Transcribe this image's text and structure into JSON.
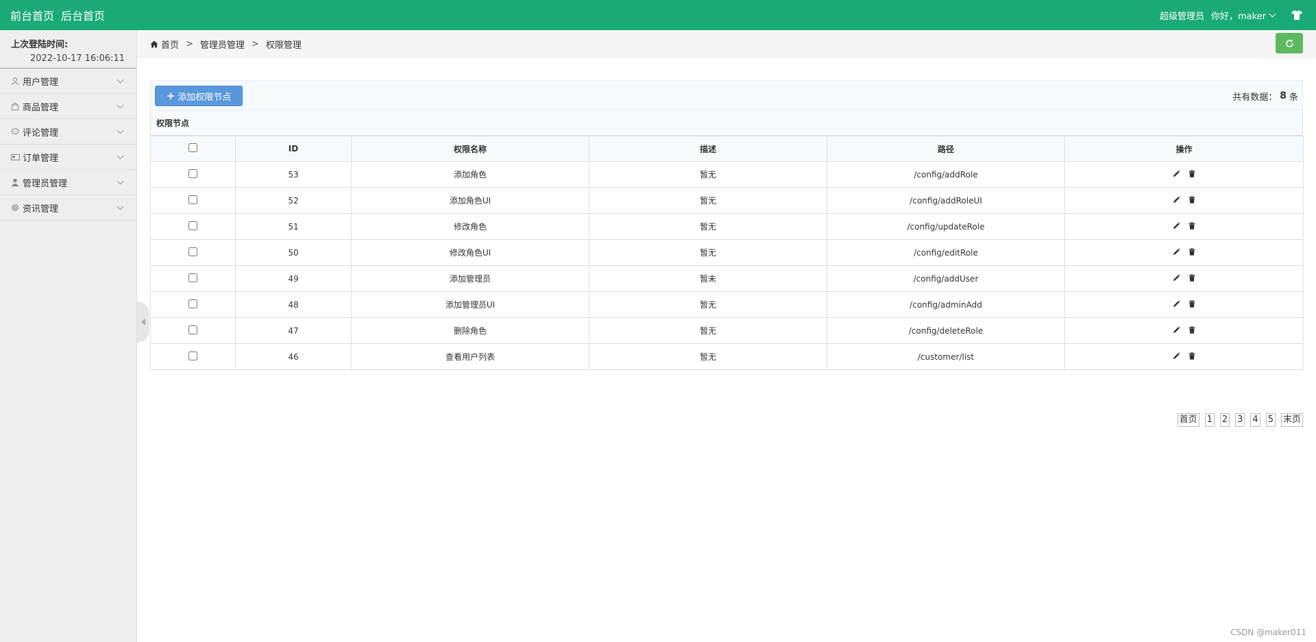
{
  "topbar": {
    "front_home": "前台首页",
    "back_home": "后台首页",
    "role": "超级管理员",
    "greeting": "你好，maker",
    "accent": "#1aaa78"
  },
  "sidebar": {
    "login_label": "上次登陆时间:",
    "login_time": "2022-10-17 16:06:11",
    "items": [
      {
        "label": "用户管理",
        "icon": "user-icon"
      },
      {
        "label": "商品管理",
        "icon": "bag-icon"
      },
      {
        "label": "评论管理",
        "icon": "comment-icon"
      },
      {
        "label": "订单管理",
        "icon": "card-icon"
      },
      {
        "label": "管理员管理",
        "icon": "admin-icon"
      },
      {
        "label": "资讯管理",
        "icon": "gear-icon"
      }
    ]
  },
  "breadcrumb": {
    "home": "首页",
    "sep": ">",
    "level1": "管理员管理",
    "level2": "权限管理"
  },
  "toolbar": {
    "add_label": "添加权限节点",
    "total_prefix": "共有数据：",
    "total_count": "8",
    "total_suffix": "条"
  },
  "table": {
    "caption": "权限节点",
    "headers": {
      "id": "ID",
      "name": "权限名称",
      "desc": "描述",
      "path": "路径",
      "ops": "操作"
    },
    "rows": [
      {
        "id": "53",
        "name": "添加角色",
        "desc": "暂无",
        "path": "/config/addRole"
      },
      {
        "id": "52",
        "name": "添加角色UI",
        "desc": "暂无",
        "path": "/config/addRoleUI"
      },
      {
        "id": "51",
        "name": "修改角色",
        "desc": "暂无",
        "path": "/config/updateRole"
      },
      {
        "id": "50",
        "name": "修改角色UI",
        "desc": "暂无",
        "path": "/config/editRole"
      },
      {
        "id": "49",
        "name": "添加管理员",
        "desc": "暂未",
        "path": "/config/addUser"
      },
      {
        "id": "48",
        "name": "添加管理员UI",
        "desc": "暂无",
        "path": "/config/adminAdd"
      },
      {
        "id": "47",
        "name": "删除角色",
        "desc": "暂无",
        "path": "/config/deleteRole"
      },
      {
        "id": "46",
        "name": "查看用户列表",
        "desc": "暂无",
        "path": "/customer/list"
      }
    ]
  },
  "pager": {
    "first": "首页",
    "pages": [
      "1",
      "2",
      "3",
      "4",
      "5"
    ],
    "last": "末页"
  },
  "watermark": "CSDN @maker011"
}
